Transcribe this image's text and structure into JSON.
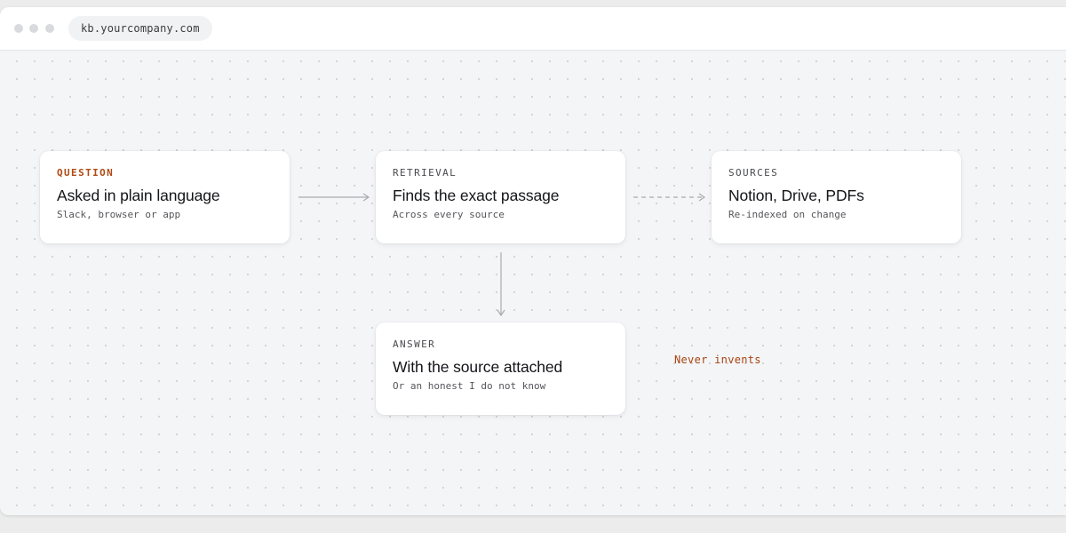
{
  "browser": {
    "url": "kb.yourcompany.com"
  },
  "flow": {
    "question": {
      "eyebrow": "QUESTION",
      "title": "Asked in plain language",
      "subtitle": "Slack, browser or app"
    },
    "retrieval": {
      "eyebrow": "RETRIEVAL",
      "title": "Finds the exact passage",
      "subtitle": "Across every source"
    },
    "sources": {
      "eyebrow": "SOURCES",
      "title": "Notion, Drive, PDFs",
      "subtitle": "Re-indexed on change"
    },
    "answer": {
      "eyebrow": "ANSWER",
      "title": "With the source attached",
      "subtitle": "Or an honest I do not know"
    },
    "note": "Never invents"
  },
  "colors": {
    "accent": "#b04a14",
    "card_bg": "#ffffff",
    "canvas_bg": "#f4f5f7",
    "connector": "#a9abb1"
  }
}
